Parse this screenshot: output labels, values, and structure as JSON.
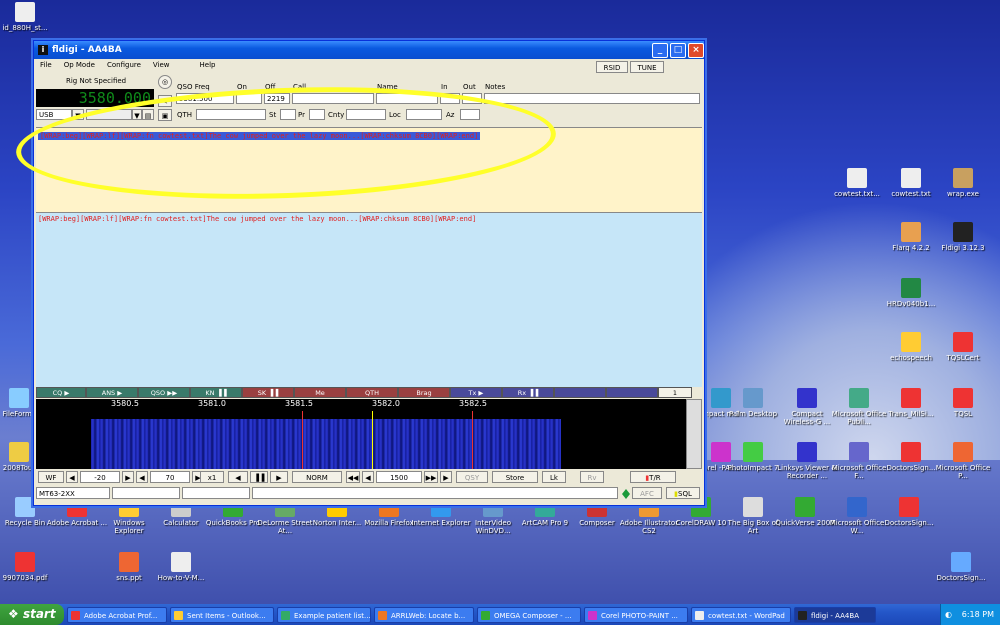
{
  "window": {
    "title": "fldigi - AA4BA"
  },
  "menu": [
    "File",
    "Op Mode",
    "Configure",
    "View",
    "Help"
  ],
  "top_buttons": {
    "rsid": "RSID",
    "tune": "TUNE"
  },
  "rig": {
    "label": "Rig Not Specified",
    "freq_display": "3580.000",
    "mode": "USB"
  },
  "log": {
    "qso_freq_label": "QSO Freq",
    "qso_freq": "3581.500",
    "on_label": "On",
    "on": "",
    "off_label": "Off",
    "off": "2219",
    "call_label": "Call",
    "call": "",
    "name_label": "Name",
    "name": "",
    "in_label": "In",
    "out_label": "Out",
    "notes_label": "Notes",
    "qth_label": "QTH",
    "st_label": "St",
    "pr_label": "Pr",
    "cnty_label": "Cnty",
    "loc_label": "Loc",
    "az_label": "Az"
  },
  "rx_text": "[WRAP:beg][WRAP:lf][WRAP:fn cowtest.txt]The cow jumped over the lazy moon...[WRAP:chksum 8CB0][WRAP:end]",
  "tx_text": "[WRAP:beg][WRAP:lf][WRAP:fn cowtest.txt]The cow jumped over the lazy moon...[WRAP:chksum 8CB0][WRAP:end]",
  "macros": [
    {
      "label": "CQ ▶",
      "color": "#3a7a6a"
    },
    {
      "label": "ANS ▶",
      "color": "#3a7a6a"
    },
    {
      "label": "QSO ▶▶",
      "color": "#3a7a6a"
    },
    {
      "label": "KN ▐▐",
      "color": "#3a7a6a"
    },
    {
      "label": "SK ▐▐",
      "color": "#9a4040"
    },
    {
      "label": "Me",
      "color": "#9a4040"
    },
    {
      "label": "QTH",
      "color": "#9a4040"
    },
    {
      "label": "Brag",
      "color": "#9a4040"
    },
    {
      "label": "Tx ▶",
      "color": "#4a4a9a"
    },
    {
      "label": "Rx ▐▐",
      "color": "#4a4a9a"
    },
    {
      "label": "",
      "color": "#4a4a9a"
    },
    {
      "label": "",
      "color": "#4a4a9a"
    }
  ],
  "macro_page": "1",
  "scale_ticks": [
    "3580.5",
    "3581.0",
    "3581.5",
    "3582.0",
    "3582.5"
  ],
  "controls": {
    "wf": "WF",
    "level": "-20",
    "range": "70",
    "zoom": "x1",
    "speed": "NORM",
    "carrier": "1500",
    "qsy": "QSY",
    "store": "Store",
    "lk": "Lk",
    "rv": "Rv",
    "tr": "T/R"
  },
  "status": {
    "mode": "MT63-2XX",
    "afc": "AFC",
    "sql": "SQL"
  },
  "taskbar": {
    "start": "start",
    "tasks": [
      "Adobe Acrobat Prof...",
      "Sent Items - Outlook...",
      "Example patient list....",
      "ARRLWeb: Locate b...",
      "OMEGA Composer - ...",
      "Corel PHOTO-PAINT ...",
      "cowtest.txt - WordPad",
      "fldigi - AA4BA"
    ],
    "clock": "6:18 PM"
  },
  "desktop_icons_right": [
    {
      "label": "cowtest.txt...",
      "color": "#eee"
    },
    {
      "label": "cowtest.txt",
      "color": "#eee"
    },
    {
      "label": "wrap.exe",
      "color": "#c8a060"
    },
    {
      "label": "Flarq 4.2.2",
      "color": "#e8a050"
    },
    {
      "label": "Fldigi 3.12.3",
      "color": "#222"
    },
    {
      "label": "HRDv040b1...",
      "color": "#284"
    },
    {
      "label": "echospeech",
      "color": "#fc3"
    },
    {
      "label": "TQSLCert",
      "color": "#e33"
    }
  ],
  "desktop_icons_row1": [
    "mpact m 7",
    "Palm Desktop",
    "Compact Wireless-G ...",
    "Microsoft Office Publi...",
    "Trans_MilSi...",
    "TQSL"
  ],
  "desktop_icons_row2": [
    "orel -PAI...",
    "PhotoImpact 7",
    "Linksys Viewer & Recorder ...",
    "Microsoft Office F...",
    "DoctorsSign...",
    "Microsoft Office P..."
  ],
  "desktop_icons_bottom": [
    "Recycle Bin",
    "Adobe Acrobat ...",
    "Windows Explorer",
    "Calculator",
    "QuickBooks Pro",
    "DeLorme Street At...",
    "Norton Inter...",
    "Mozilla Firefox",
    "Internet Explorer",
    "InterVideo WinDVD...",
    "ArtCAM Pro 9",
    "Composer",
    "Adobe Illustrator CS2",
    "CorelDRAW 10",
    "The Big Box of Art",
    "QuickVerse 2007",
    "Microsoft Office W...",
    "DoctorsSign...",
    "DoctorsSign..."
  ],
  "desktop_icons_left": [
    "id_880H_st...",
    "FileForms",
    "2008Tour",
    "9907034.pdf",
    "sns.ppt",
    "How-to-V-M..."
  ]
}
